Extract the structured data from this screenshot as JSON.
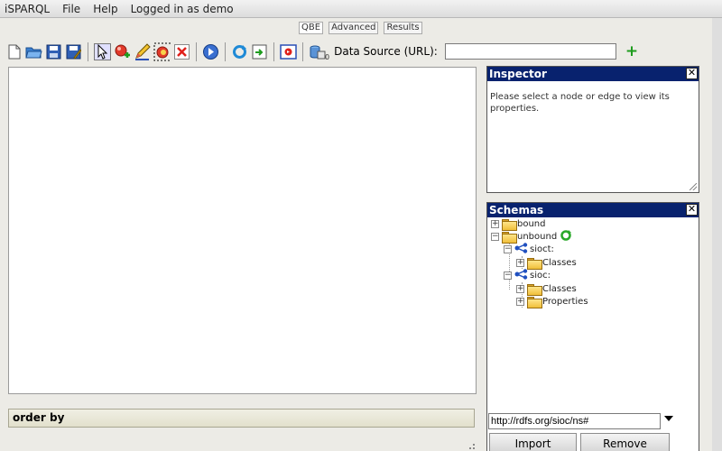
{
  "menu": [
    "iSPARQL",
    "File",
    "Help",
    "Logged in as demo"
  ],
  "tabs": [
    "QBE",
    "Advanced",
    "Results"
  ],
  "toolbar": {
    "icons": [
      "new-file-icon",
      "open-folder-icon",
      "save-icon",
      "save-as-icon",
      "select-pointer-icon",
      "add-node-icon",
      "draw-edge-icon",
      "add-group-icon",
      "delete-icon",
      "run-query-icon",
      "refresh-icon",
      "import-icon",
      "load-query-icon",
      "datasource-icon"
    ],
    "datasource_count": "0",
    "datasource_label": "Data Source (URL):",
    "datasource_value": "",
    "add_symbol": "+"
  },
  "orderby": "order by",
  "inspector": {
    "title": "Inspector",
    "close": "✕",
    "message": "Please select a node or edge to view its properties."
  },
  "schemas": {
    "title": "Schemas",
    "close": "✕",
    "tree": [
      {
        "label": "bound",
        "toggle": "+"
      },
      {
        "label": "unbound",
        "toggle": "−"
      },
      {
        "label": "sioct:",
        "toggle": "−"
      },
      {
        "label": "Classes",
        "toggle": "+"
      },
      {
        "label": "sioc:",
        "toggle": "−"
      },
      {
        "label": "Classes",
        "toggle": "+"
      },
      {
        "label": "Properties",
        "toggle": "+"
      }
    ]
  },
  "import_uri": "http://rdfs.org/sioc/ns#",
  "buttons": {
    "import": "Import",
    "remove": "Remove"
  }
}
